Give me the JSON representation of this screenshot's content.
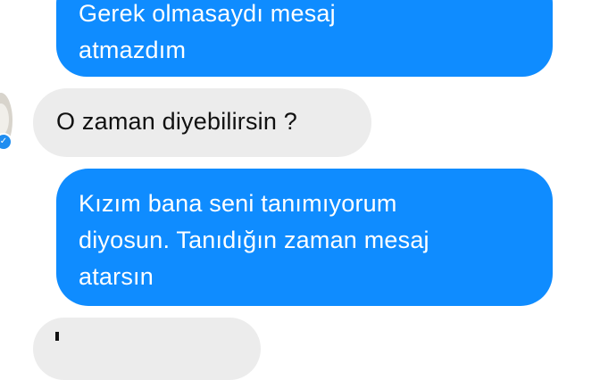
{
  "conversation": {
    "messages": [
      {
        "direction": "outgoing",
        "text": "Gerek olmasaydı mesaj\natmazdım"
      },
      {
        "direction": "incoming",
        "text": "O zaman diyebilirsin ?"
      },
      {
        "direction": "outgoing",
        "text": "Kızım bana seni tanımıyorum\ndiyosun. Tanıdığın zaman mesaj\natarsın"
      },
      {
        "direction": "incoming",
        "text": ""
      }
    ]
  },
  "icons": {
    "avatar": "contact-avatar",
    "verified_badge": "check-badge-icon"
  },
  "colors": {
    "outgoing_bubble": "#0f8cff",
    "incoming_bubble": "#ececec",
    "outgoing_text": "#ffffff",
    "incoming_text": "#111111",
    "badge": "#1f8df0"
  }
}
